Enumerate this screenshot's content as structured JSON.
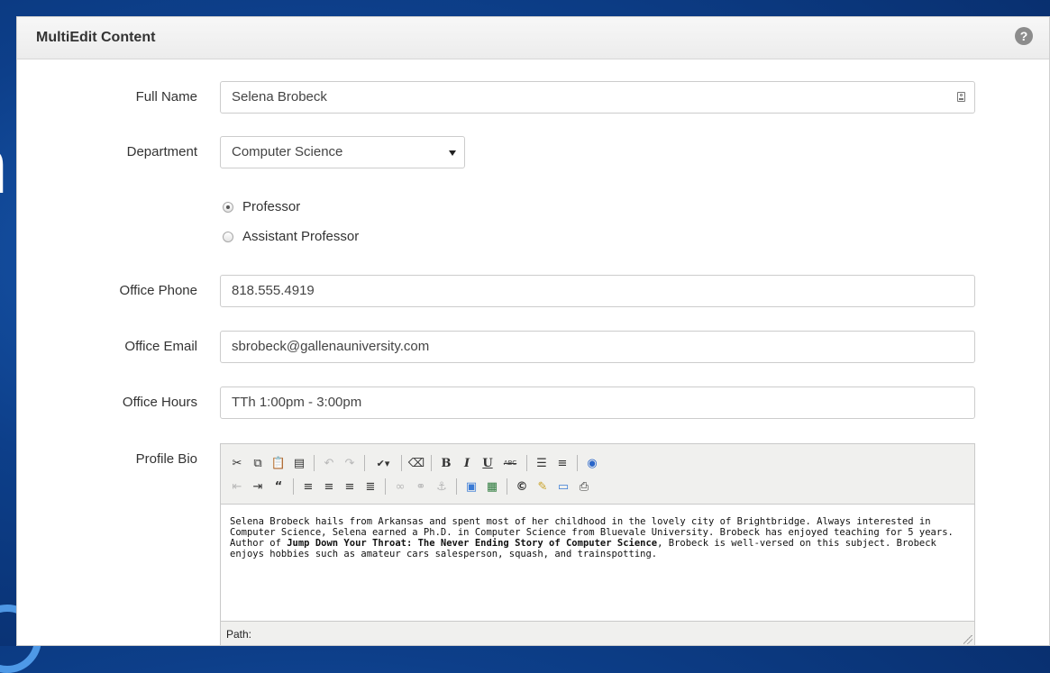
{
  "panel": {
    "title": "MultiEdit Content"
  },
  "form": {
    "full_name": {
      "label": "Full Name",
      "value": "Selena Brobeck"
    },
    "department": {
      "label": "Department",
      "selected": "Computer Science"
    },
    "title_options": [
      {
        "label": "Professor",
        "checked": true
      },
      {
        "label": "Assistant Professor",
        "checked": false
      }
    ],
    "office_phone": {
      "label": "Office Phone",
      "value": "818.555.4919"
    },
    "office_email": {
      "label": "Office Email",
      "value": "sbrobeck@gallenauniversity.com"
    },
    "office_hours": {
      "label": "Office Hours",
      "value": "TTh 1:00pm - 3:00pm"
    },
    "profile_bio": {
      "label": "Profile Bio",
      "text_before": "Selena Brobeck hails from Arkansas and spent most of her childhood in the lovely city of Brightbridge. Always interested in Computer Science, Selena earned a Ph.D. in Computer Science from Bluevale University. Brobeck has enjoyed teaching for 5 years. Author of ",
      "text_bold": "Jump Down Your Throat: The Never Ending Story of Computer Science",
      "text_after": ", Brobeck is well-versed on this subject. Brobeck enjoys hobbies such as amateur cars salesperson, squash, and trainspotting.",
      "path_label": "Path:"
    }
  },
  "toolbar": {
    "abc_label": "ABC",
    "bold": "B",
    "italic": "I",
    "underline": "U"
  }
}
